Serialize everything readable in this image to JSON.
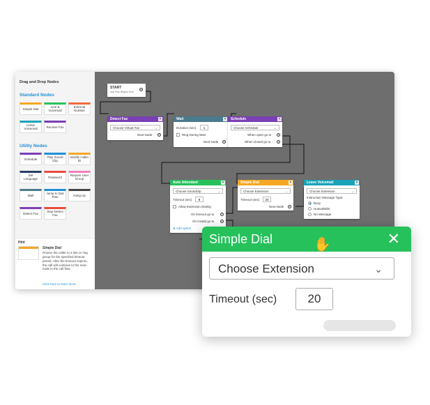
{
  "sidebar": {
    "title": "Drag and Drop Nodes",
    "standard_heading": "Standard Nodes",
    "standard_nodes": [
      {
        "label": "Simple Dial",
        "color": "#f5a623"
      },
      {
        "label": "Line & Voicemail",
        "color": "#27c15c"
      },
      {
        "label": "External Number",
        "color": "#f26b3a"
      },
      {
        "label": "Leave Voicemail",
        "color": "#1aa3b8"
      },
      {
        "label": "Receive Fax",
        "color": "#7b3fb5"
      }
    ],
    "utility_heading": "Utility Nodes",
    "utility_nodes": [
      {
        "label": "Schedule",
        "color": "#7b3fb5"
      },
      {
        "label": "Play Sound Clip",
        "color": "#1f8fd6"
      },
      {
        "label": "Modify Caller ID",
        "color": "#f5a623"
      },
      {
        "label": "Set Language",
        "color": "#2a3f6b"
      },
      {
        "label": "Password",
        "color": "#e84c3d"
      },
      {
        "label": "Require User Group",
        "color": "#f57fbf"
      },
      {
        "label": "Wait",
        "color": "#4a7b8c"
      },
      {
        "label": "Jump to Dial Plan",
        "color": "#1f8fd6"
      },
      {
        "label": "Hang Up",
        "color": "#444444"
      },
      {
        "label": "Detect Fax",
        "color": "#7b3fb5"
      },
      {
        "label": "Stop Detect Fax",
        "color": "#e84c3d"
      }
    ],
    "hint": {
      "label": "Hint",
      "title": "Simple Dial",
      "body": "Routes the caller to a line or ring group for the specified timeout period. After the timeout expires, the call will continue to the next-node in the call flow.",
      "link": "Click here to learn more."
    }
  },
  "canvas": {
    "start": {
      "title": "START",
      "subtitle": "Dial Plan Begins Here"
    },
    "detect_fax": {
      "title": "Detect Fax",
      "color": "#7b3fb5",
      "select": "Choose Virtual Fax",
      "next": "Next Node"
    },
    "wait": {
      "title": "Wait",
      "color": "#4a7b8c",
      "duration_label": "Duration (sec)",
      "duration": "1",
      "ring_label": "Ring During Wait",
      "next": "Next Node"
    },
    "schedule": {
      "title": "Schedule",
      "color": "#7b3fb5",
      "select": "Choose Schedule",
      "open": "When open go to",
      "closed": "When closed go to"
    },
    "auto_attendant": {
      "title": "Auto Attendant",
      "color": "#27c15c",
      "select": "Choose Soundclip",
      "timeout_label": "Timeout (sec)",
      "timeout": "8",
      "allow_label": "Allow Extension Dialing",
      "on_timeout": "On timeout go to",
      "on_invalid": "On invalid go to",
      "add_option": "Add option"
    },
    "simple_dial": {
      "title": "Simple Dial",
      "color": "#f5a623",
      "select": "Choose Extension",
      "timeout_label": "Timeout (sec)",
      "timeout": "20",
      "next": "Next Node"
    },
    "leave_voicemail": {
      "title": "Leave Voicemail",
      "color": "#1aa3b8",
      "select": "Choose Extension",
      "instruction_label": "Instruction Message Type:",
      "options": [
        "Busy",
        "Unavailable",
        "No Message"
      ]
    }
  },
  "popup": {
    "title": "Simple Dial",
    "color": "#27c15c",
    "select": "Choose Extension",
    "timeout_label": "Timeout (sec)",
    "timeout": "20"
  }
}
